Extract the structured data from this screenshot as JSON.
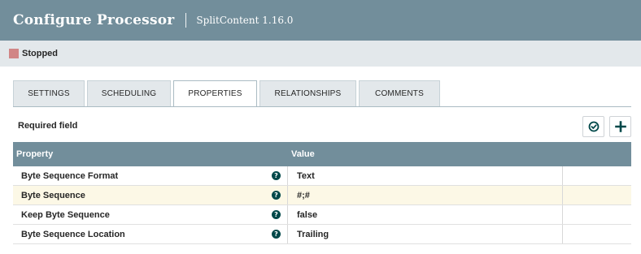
{
  "header": {
    "title": "Configure Processor",
    "subtitle": "SplitContent 1.16.0"
  },
  "status": {
    "text": "Stopped",
    "color": "#d18686"
  },
  "tabs": [
    {
      "label": "SETTINGS"
    },
    {
      "label": "SCHEDULING"
    },
    {
      "label": "PROPERTIES",
      "active": true
    },
    {
      "label": "RELATIONSHIPS"
    },
    {
      "label": "COMMENTS"
    }
  ],
  "required_label": "Required field",
  "toolbar": {
    "verify_icon": "check-circle-icon",
    "add_icon": "plus-icon"
  },
  "table": {
    "headers": {
      "property": "Property",
      "value": "Value"
    },
    "rows": [
      {
        "property": "Byte Sequence Format",
        "value": "Text"
      },
      {
        "property": "Byte Sequence",
        "value": "#;#"
      },
      {
        "property": "Keep Byte Sequence",
        "value": "false"
      },
      {
        "property": "Byte Sequence Location",
        "value": "Trailing"
      }
    ]
  },
  "colors": {
    "header": "#728e9b",
    "accent": "#004849",
    "highlight_row": "#fcf8e6"
  }
}
